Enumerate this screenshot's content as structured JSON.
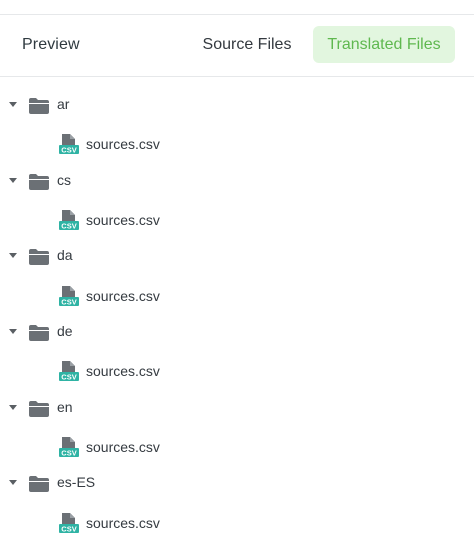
{
  "header": {
    "title": "Preview",
    "tabs": [
      {
        "label": "Source Files",
        "active": false
      },
      {
        "label": "Translated Files",
        "active": true
      }
    ],
    "active_tab_bg": "#e2f6df",
    "active_tab_color": "#5fb84f"
  },
  "tree": {
    "folders": [
      {
        "name": "ar",
        "expanded": true,
        "files": [
          {
            "name": "sources.csv",
            "icon": "csv-file-icon"
          }
        ]
      },
      {
        "name": "cs",
        "expanded": true,
        "files": [
          {
            "name": "sources.csv",
            "icon": "csv-file-icon"
          }
        ]
      },
      {
        "name": "da",
        "expanded": true,
        "files": [
          {
            "name": "sources.csv",
            "icon": "csv-file-icon"
          }
        ]
      },
      {
        "name": "de",
        "expanded": true,
        "files": [
          {
            "name": "sources.csv",
            "icon": "csv-file-icon"
          }
        ]
      },
      {
        "name": "en",
        "expanded": true,
        "files": [
          {
            "name": "sources.csv",
            "icon": "csv-file-icon"
          }
        ]
      },
      {
        "name": "es-ES",
        "expanded": true,
        "files": [
          {
            "name": "sources.csv",
            "icon": "csv-file-icon"
          }
        ]
      }
    ],
    "csv_badge": "CSV",
    "csv_color": "#2fb3a4",
    "folder_color": "#6b7075"
  }
}
